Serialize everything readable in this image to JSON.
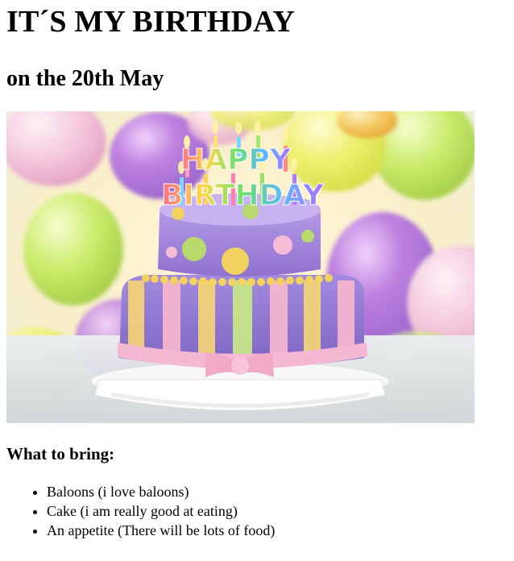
{
  "page": {
    "title": "IT´S MY BIRTHDAY",
    "subtitle": "on the 20th May",
    "image_label": "HAPPY BIRTHDAY",
    "image_label_line1": "HAPPY",
    "image_label_line2": "BIRTHDAY",
    "bring_heading": "What to bring:",
    "bring_items": [
      "Baloons (i love baloons)",
      "Cake (i am really good at eating)",
      "An appetite (There will be lots of food)"
    ]
  },
  "colors": {
    "text": "#000000",
    "background": "#ffffff",
    "balloon_purple": "#b57bd6",
    "balloon_yellow": "#e7ee5c",
    "balloon_green": "#c6ec63",
    "balloon_pink": "#f3bfd8",
    "cake_purple": "#a98bd9",
    "cake_pink": "#f2b8d3"
  }
}
